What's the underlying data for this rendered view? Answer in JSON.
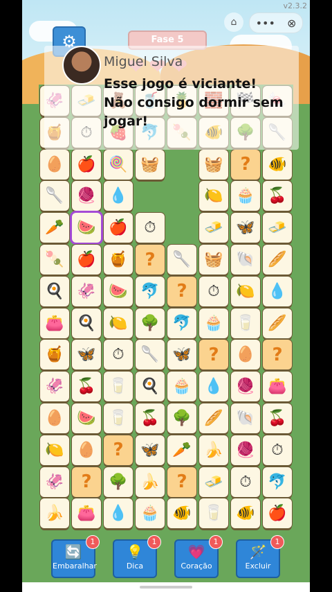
{
  "header": {
    "version": "v2.3.2",
    "level": "Fase 5",
    "hearts": [
      "❤",
      "❤",
      "❤"
    ]
  },
  "testimonial": {
    "name": "Miguel Silva",
    "message": "Esse jogo é viciante! Não consigo dormir sem jogar!"
  },
  "board": {
    "rows": [
      [
        "🦑",
        "🧈",
        "🧸",
        "🥤",
        "🍍",
        "🧱",
        "🏁",
        "🍬",
        "🧺"
      ],
      [
        "🍯",
        "⏱",
        "🍓",
        "🐬",
        "🍡",
        "🐠",
        "🌳",
        "🥄",
        ""
      ],
      [
        "🥚",
        "🍎",
        "🍭",
        "🧺",
        "",
        "🧺",
        "?",
        "🐠",
        ""
      ],
      [
        "🥄",
        "🧶",
        "💧",
        "",
        "",
        "🍋",
        "🧁",
        "🍒",
        ""
      ],
      [
        "🥕",
        "🍉",
        "🍎",
        "⏱",
        "",
        "🧈",
        "🦋",
        "🧈",
        ""
      ],
      [
        "🍡",
        "🍎",
        "🍯",
        "?",
        "🥄",
        "🧺",
        "🐚",
        "🥖",
        ""
      ],
      [
        "🍳",
        "🦑",
        "🍉",
        "🐬",
        "?",
        "⏱",
        "🍋",
        "💧",
        ""
      ],
      [
        "👛",
        "🍳",
        "🍋",
        "🌳",
        "🐬",
        "🧁",
        "🥛",
        "🥖",
        ""
      ],
      [
        "🍯",
        "🦋",
        "⏱",
        "🥄",
        "🦋",
        "?",
        "🥚",
        "?",
        ""
      ],
      [
        "🦑",
        "🍒",
        "🥛",
        "🍳",
        "🧁",
        "💧",
        "🧶",
        "👛",
        ""
      ],
      [
        "🥚",
        "🍉",
        "🥛",
        "🍒",
        "🌳",
        "🥖",
        "🐚",
        "🍒",
        ""
      ],
      [
        "🍋",
        "🥚",
        "?",
        "🦋",
        "🥕",
        "🍌",
        "🧶",
        "⏱",
        ""
      ],
      [
        "🦑",
        "?",
        "🌳",
        "🍌",
        "?",
        "🧈",
        "⏱",
        "🐬",
        ""
      ],
      [
        "🍌",
        "👛",
        "💧",
        "🧁",
        "🐠",
        "🥛",
        "🐠",
        "🍎",
        ""
      ]
    ]
  },
  "powerups": [
    {
      "label": "Embaralhar",
      "icon": "🔄",
      "count": "1"
    },
    {
      "label": "Dica",
      "icon": "💡",
      "count": "1"
    },
    {
      "label": "Coração",
      "icon": "💗",
      "count": "1"
    },
    {
      "label": "Excluir",
      "icon": "🪄",
      "count": "1"
    }
  ]
}
